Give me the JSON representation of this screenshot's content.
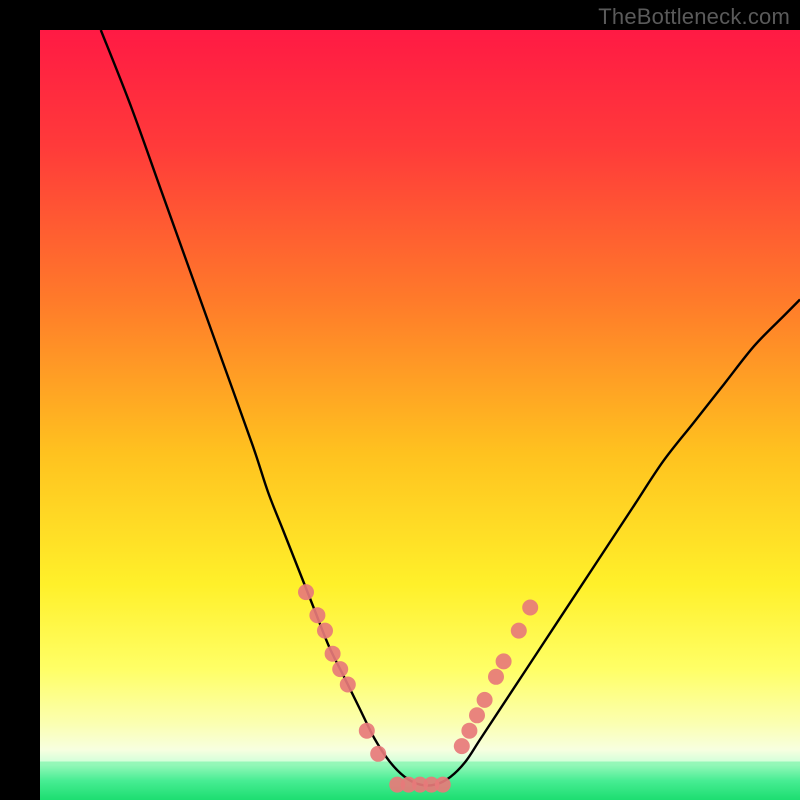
{
  "watermark": "TheBottleneck.com",
  "chart_data": {
    "type": "line",
    "title": "",
    "xlabel": "",
    "ylabel": "",
    "xlim": [
      0,
      100
    ],
    "ylim": [
      0,
      100
    ],
    "grid": false,
    "curve": {
      "name": "bottleneck-curve",
      "x": [
        8,
        12,
        16,
        20,
        24,
        28,
        30,
        32,
        34,
        36,
        38,
        40,
        42,
        44,
        46,
        48,
        50,
        52,
        54,
        56,
        58,
        62,
        66,
        70,
        74,
        78,
        82,
        86,
        90,
        94,
        98,
        100
      ],
      "y": [
        100,
        90,
        79,
        68,
        57,
        46,
        40,
        35,
        30,
        25,
        20,
        16,
        12,
        8,
        5,
        3,
        2,
        2,
        3,
        5,
        8,
        14,
        20,
        26,
        32,
        38,
        44,
        49,
        54,
        59,
        63,
        65
      ]
    },
    "markers_left": {
      "name": "left-branch-dots",
      "x": [
        35,
        36.5,
        37.5,
        38.5,
        39.5,
        40.5,
        43,
        44.5
      ],
      "y": [
        27,
        24,
        22,
        19,
        17,
        15,
        9,
        6
      ]
    },
    "markers_right": {
      "name": "right-branch-dots",
      "x": [
        55.5,
        56.5,
        57.5,
        58.5,
        60,
        61,
        63,
        64.5
      ],
      "y": [
        7,
        9,
        11,
        13,
        16,
        18,
        22,
        25
      ]
    },
    "markers_bottom": {
      "name": "valley-dots",
      "x": [
        47,
        48.5,
        50,
        51.5,
        53
      ],
      "y": [
        2,
        2,
        2,
        2,
        2
      ]
    },
    "bottom_band": {
      "y_start": 0,
      "y_end": 5,
      "color": "#2ae87a"
    },
    "marker_color": "#e77a7a",
    "curve_color": "#000000",
    "gradient_stops": [
      {
        "offset": 0.0,
        "color": "#ff1a44"
      },
      {
        "offset": 0.15,
        "color": "#ff3a3a"
      },
      {
        "offset": 0.35,
        "color": "#ff7a2a"
      },
      {
        "offset": 0.55,
        "color": "#ffc21f"
      },
      {
        "offset": 0.72,
        "color": "#fff02a"
      },
      {
        "offset": 0.83,
        "color": "#ffff66"
      },
      {
        "offset": 0.9,
        "color": "#fbffb0"
      },
      {
        "offset": 0.935,
        "color": "#f7ffe0"
      },
      {
        "offset": 0.955,
        "color": "#c8ffd8"
      },
      {
        "offset": 0.975,
        "color": "#57f0a0"
      },
      {
        "offset": 1.0,
        "color": "#15d86b"
      }
    ]
  }
}
